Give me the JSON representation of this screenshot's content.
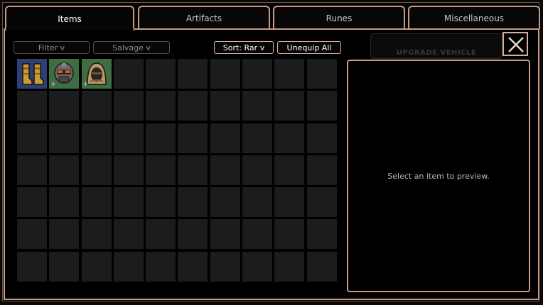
{
  "tabs": [
    {
      "label": "Items",
      "active": true
    },
    {
      "label": "Artifacts",
      "active": false
    },
    {
      "label": "Runes",
      "active": false
    },
    {
      "label": "Miscellaneous",
      "active": false
    }
  ],
  "toolbar": {
    "filter_label": "Filter v",
    "salvage_label": "Salvage v",
    "sort_label": "Sort: Rar v",
    "unequip_label": "Unequip All"
  },
  "hidden_panel_title": "UPGRADE VEHICLE",
  "inventory": {
    "columns": 10,
    "rows": 7,
    "items": [
      {
        "name": "boots",
        "bg": "#2d3f76",
        "plus": false
      },
      {
        "name": "helmet",
        "bg": "#3f6e45",
        "plus": true
      },
      {
        "name": "hood",
        "bg": "#3f6e45",
        "plus": true
      }
    ]
  },
  "preview": {
    "empty_text": "Select an item to preview."
  },
  "colors": {
    "border_accent": "#c89a84",
    "slot_empty": "#1b1c1e",
    "rarity_blue": "#2d3f76",
    "rarity_green": "#3f6e45"
  }
}
